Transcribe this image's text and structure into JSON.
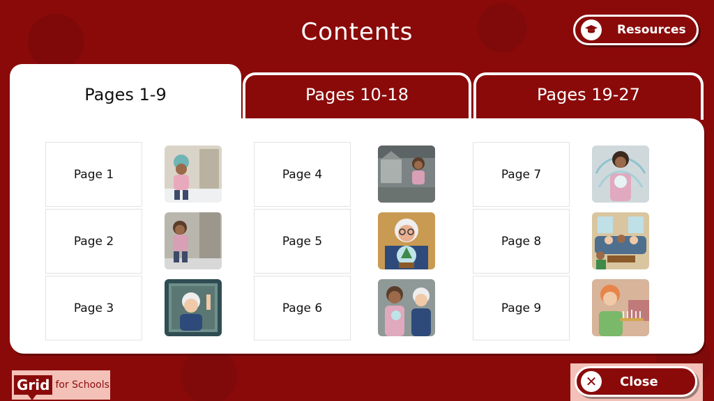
{
  "header": {
    "title": "Contents",
    "resources_label": "Resources"
  },
  "tabs": [
    {
      "label": "Pages 1-9",
      "active": true
    },
    {
      "label": "Pages 10-18",
      "active": false
    },
    {
      "label": "Pages 19-27",
      "active": false
    }
  ],
  "pages": [
    {
      "label": "Page 1"
    },
    {
      "label": "Page 2"
    },
    {
      "label": "Page 3"
    },
    {
      "label": "Page 4"
    },
    {
      "label": "Page 5"
    },
    {
      "label": "Page 6"
    },
    {
      "label": "Page 7"
    },
    {
      "label": "Page 8"
    },
    {
      "label": "Page 9"
    }
  ],
  "footer": {
    "logo_grid": "Grid",
    "logo_for_schools": "for Schools",
    "close_label": "Close"
  },
  "colors": {
    "brand": "#8a0a0a",
    "accent_light": "#f3c1b8",
    "panel": "#ffffff"
  },
  "icons": {
    "resources": "graduation-cap-icon",
    "close": "close-icon"
  }
}
